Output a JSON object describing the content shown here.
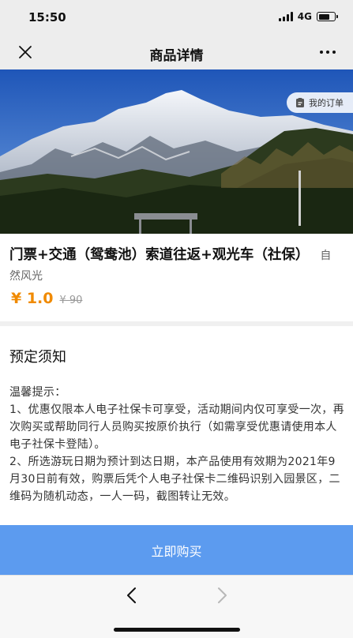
{
  "status_bar": {
    "time": "15:50",
    "network": "4G"
  },
  "nav": {
    "title": "商品详情"
  },
  "hero": {
    "order_button_label": "我的订单"
  },
  "product": {
    "title": "门票+交通（鸳鸯池）索道往返+观光车（社保）",
    "tag": "自然风光",
    "price": "¥ 1.0",
    "original_price": "¥ 90"
  },
  "notice": {
    "heading": "预定须知",
    "subheading": "温馨提示：",
    "items": [
      "1、优惠仅限本人电子社保卡可享受，活动期间内仅可享受一次，再次购买或帮助同行人员购买按原价执行（如需享受优惠请使用本人电子社保卡登陆）。",
      "2、所选游玩日期为预计到达日期，本产品使用有效期为2021年9月30日前有效，购票后凭个人电子社保卡二维码识别入园景区，二维码为随机动态，一人一码，截图转让无效。"
    ]
  },
  "buy_button": {
    "label": "立即购买"
  },
  "colors": {
    "accent": "#5c9bef",
    "price": "#f08a00",
    "bar_bg": "#ededed"
  },
  "icons": [
    "close-icon",
    "more-icon",
    "order-icon",
    "back-chevron-icon",
    "forward-chevron-icon"
  ]
}
